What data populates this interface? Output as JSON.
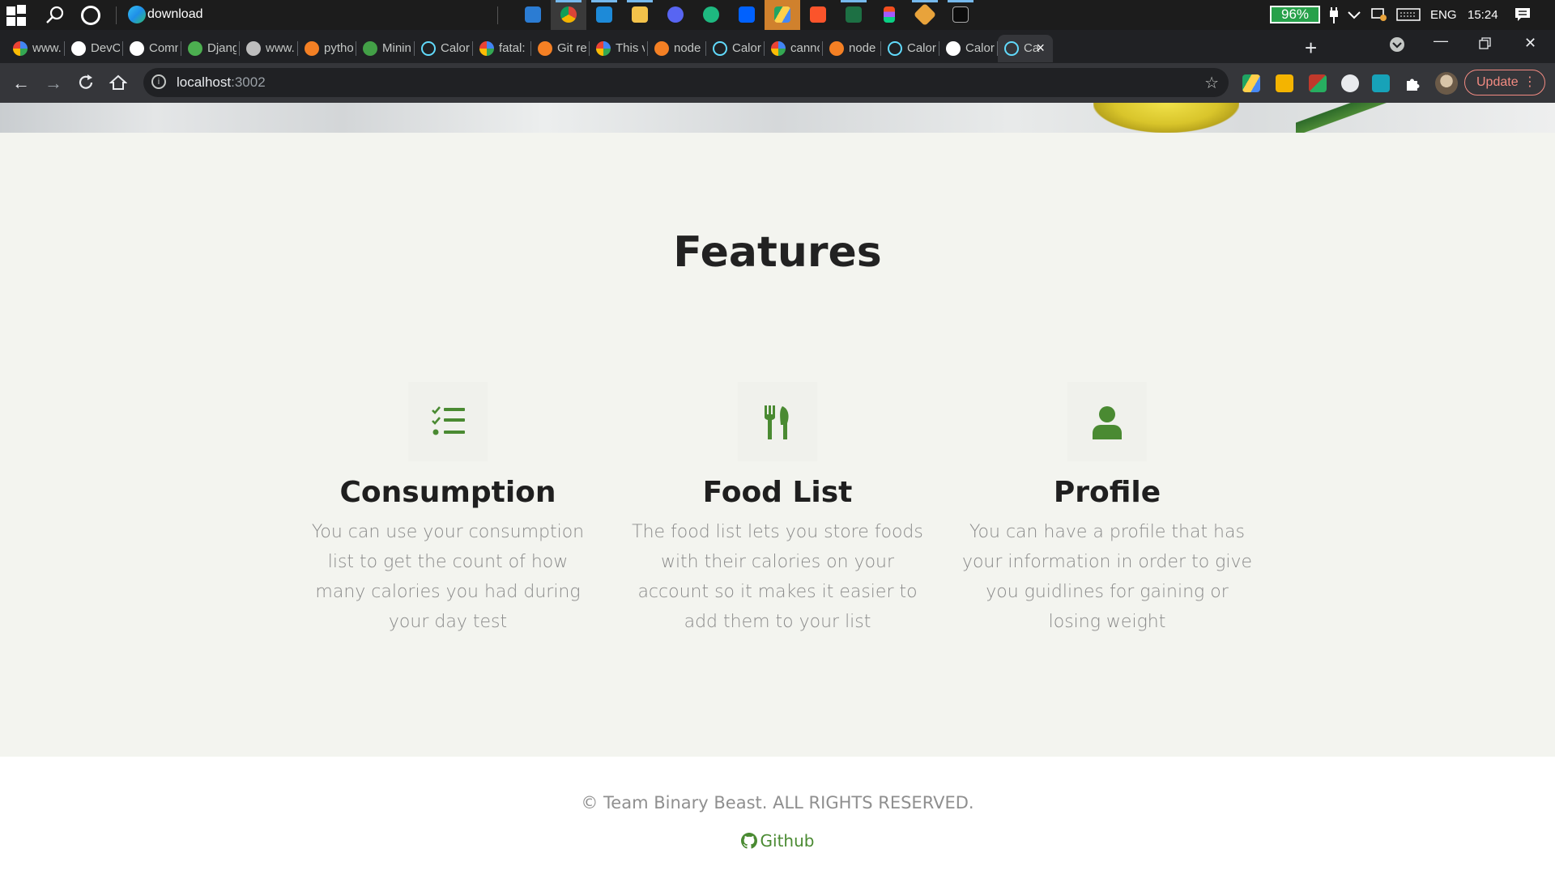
{
  "taskbar": {
    "active_window_label": "download",
    "battery_label": "96%",
    "language": "ENG",
    "time": "15:24"
  },
  "browser": {
    "tabs": [
      {
        "title": "www.",
        "icon": "google-icon"
      },
      {
        "title": "DevC",
        "icon": "github-icon"
      },
      {
        "title": "Comn",
        "icon": "github-icon"
      },
      {
        "title": "Djang",
        "icon": "mongodb-leaf-icon"
      },
      {
        "title": "www.",
        "icon": "globe-icon"
      },
      {
        "title": "pytho",
        "icon": "stackoverflow-icon"
      },
      {
        "title": "Minin",
        "icon": "link-icon"
      },
      {
        "title": "Calori",
        "icon": "react-icon"
      },
      {
        "title": "fatal:",
        "icon": "google-icon"
      },
      {
        "title": "Git re",
        "icon": "stackoverflow-icon"
      },
      {
        "title": "This v",
        "icon": "google-icon"
      },
      {
        "title": "node",
        "icon": "stackoverflow-icon"
      },
      {
        "title": "Calori",
        "icon": "react-icon"
      },
      {
        "title": "canno",
        "icon": "google-icon"
      },
      {
        "title": "node",
        "icon": "stackoverflow-icon"
      },
      {
        "title": "Calori",
        "icon": "react-icon"
      },
      {
        "title": "Calori",
        "icon": "github-icon"
      },
      {
        "title": "Ca",
        "icon": "react-icon",
        "active": true
      }
    ],
    "url_host": "localhost",
    "url_port": ":3002",
    "update_label": "Update"
  },
  "page": {
    "heading": "Features",
    "features": [
      {
        "icon": "task-list-icon",
        "title": "Consumption",
        "description": "You can use your consumption list to get the count of how many calories you had during your day test"
      },
      {
        "icon": "fork-knife-icon",
        "title": "Food List",
        "description": "The food list lets you store foods with their calories on your account so it makes it easier to add them to your list"
      },
      {
        "icon": "user-icon",
        "title": "Profile",
        "description": "You can have a profile that has your information in order to give you guidlines for gaining or losing weight"
      }
    ],
    "footer": {
      "copyright": "© Team Binary Beast. ALL RIGHTS RESERVED.",
      "github_label": "Github"
    },
    "colors": {
      "accent_green": "#4a8a32",
      "page_bg": "#f3f4ef"
    }
  }
}
